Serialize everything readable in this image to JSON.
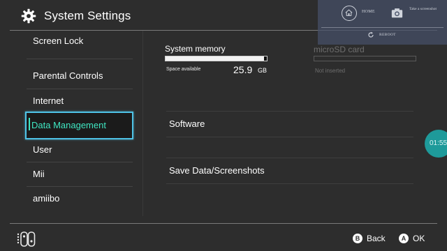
{
  "header": {
    "title": "System Settings",
    "icon": "gear-icon"
  },
  "overlay": {
    "home_label": "HOME",
    "screenshot_label": "Take a screenshot",
    "reboot_label": "REBOOT"
  },
  "sidebar": {
    "items": [
      {
        "label": "Screen Lock"
      },
      {
        "label": "Parental Controls"
      },
      {
        "label": "Internet"
      },
      {
        "label": "Data Management",
        "selected": true
      },
      {
        "label": "User"
      },
      {
        "label": "Mii"
      },
      {
        "label": "amiibo"
      }
    ]
  },
  "storage": {
    "system_memory_label": "System memory",
    "space_available_label": "Space available",
    "space_value": "25.9",
    "space_unit": "GB",
    "system_memory_used_fraction": 0.97,
    "microsd_label": "microSD card",
    "microsd_status": "Not inserted"
  },
  "main": {
    "items": [
      {
        "label": "Software"
      },
      {
        "label": "Save Data/Screenshots"
      }
    ]
  },
  "clock": {
    "time": "01:55"
  },
  "footer": {
    "back_button": "B",
    "back_label": "Back",
    "ok_button": "A",
    "ok_label": "OK"
  },
  "colors": {
    "background": "#2d2d2d",
    "selection_border": "#4fc3e6",
    "selection_text": "#3fe6c2",
    "clock_bubble": "#1e9a9a"
  }
}
